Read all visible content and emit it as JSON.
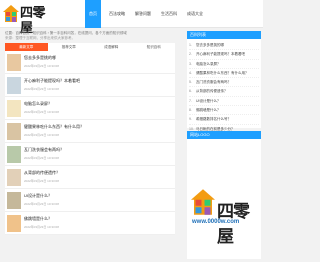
{
  "logo": {
    "text": "四零屋"
  },
  "nav": [
    {
      "label": "首页",
      "active": true
    },
    {
      "label": "百法攻略",
      "active": false
    },
    {
      "label": "解答问题",
      "active": false
    },
    {
      "label": "生活百科",
      "active": false
    },
    {
      "label": "成语大全",
      "active": false
    }
  ],
  "breadcrumb": "位置：百科首页 › 知识百科 › 第一手百科问答，在线提问，各个方面的知识领域",
  "subtitle": "来源：整理于互联网，分享出来供大家参考。",
  "tabs": [
    {
      "label": "最新文章",
      "active": true
    },
    {
      "label": "推荐文章",
      "active": false
    },
    {
      "label": "成语解释",
      "active": false
    },
    {
      "label": "知识百科",
      "active": false
    }
  ],
  "articles": [
    {
      "title": "您去多多是挑的哪",
      "meta": "2022年03月23日 10:33:08"
    },
    {
      "title": "开心麻利子能提现吗？本着看吧",
      "meta": "2022年03月23日 10:33:08"
    },
    {
      "title": "电脑怎么录屏？",
      "meta": "2022年03月23日 10:33:08"
    },
    {
      "title": "健酸果林吃什么东西？有什么用？",
      "meta": "2022年03月23日 10:33:08"
    },
    {
      "title": "瓦门洗衣服会有两吗？",
      "meta": "2022年03月23日 10:33:08"
    },
    {
      "title": "从背部的传便遗传？",
      "meta": "2022年03月23日 10:33:08"
    },
    {
      "title": "UI设计是什么？",
      "meta": "2022年03月23日 10:33:08"
    },
    {
      "title": "佛跳墙是什么？",
      "meta": "2022年03月23日 10:33:08"
    }
  ],
  "sidebar_hot": {
    "title": "百科列表",
    "items": [
      "您去多多是挑的哪",
      "开心麻利子能提现吗？本着看吧",
      "电脑怎么录屏？",
      "健酸果林吃什么东西？有什么用？",
      "瓦门洗衣服会有两吗？",
      "从背部的传便遗传？",
      "UI设计是什么？",
      "佛跳墙是什么？",
      "希腊路数排名什么号？",
      "马日帐的在前是多少分？"
    ]
  },
  "sidebar_logo": {
    "title": "网站LOGO",
    "brand": "四零屋",
    "url": "www.0000w.com"
  },
  "colors": {
    "accent": "#1e9fff",
    "tab_active": "#ff5722"
  }
}
